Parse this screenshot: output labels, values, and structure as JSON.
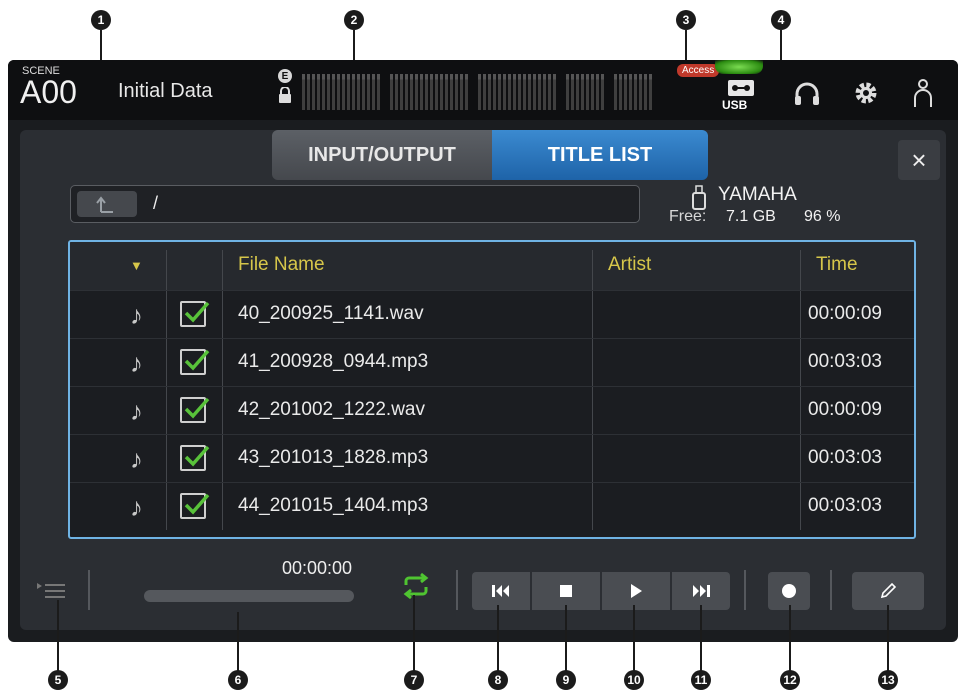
{
  "header": {
    "scene_label": "SCENE",
    "scene_number": "A00",
    "scene_name": "Initial Data",
    "e_badge": "E",
    "access_badge": "Access",
    "usb_label": "USB"
  },
  "tabs": [
    {
      "label": "INPUT/OUTPUT",
      "active": false
    },
    {
      "label": "TITLE LIST",
      "active": true
    }
  ],
  "close_label": "×",
  "path": {
    "value": "/"
  },
  "device": {
    "name": "YAMAHA",
    "free_label": "Free:",
    "free_value": "7.1 GB",
    "free_percent": "96 %"
  },
  "table": {
    "columns": {
      "sort": "▼",
      "file": "File Name",
      "artist": "Artist",
      "time": "Time"
    },
    "rows": [
      {
        "file": "40_200925_1141.wav",
        "artist": "",
        "time": "00:00:09",
        "checked": true
      },
      {
        "file": "41_200928_0944.mp3",
        "artist": "",
        "time": "00:03:03",
        "checked": true
      },
      {
        "file": "42_201002_1222.wav",
        "artist": "",
        "time": "00:00:09",
        "checked": true
      },
      {
        "file": "43_201013_1828.mp3",
        "artist": "",
        "time": "00:03:03",
        "checked": true
      },
      {
        "file": "44_201015_1404.mp3",
        "artist": "",
        "time": "00:03:03",
        "checked": true
      }
    ]
  },
  "transport": {
    "elapsed": "00:00:00",
    "progress_fraction": 0.0
  },
  "callouts": [
    "1",
    "2",
    "3",
    "4",
    "5",
    "6",
    "7",
    "8",
    "9",
    "10",
    "11",
    "12",
    "13"
  ],
  "colors": {
    "accent_blue": "#2f7ac2",
    "header_gold": "#d6c64a",
    "check_green": "#58c23a",
    "repeat_green": "#4fc431"
  }
}
